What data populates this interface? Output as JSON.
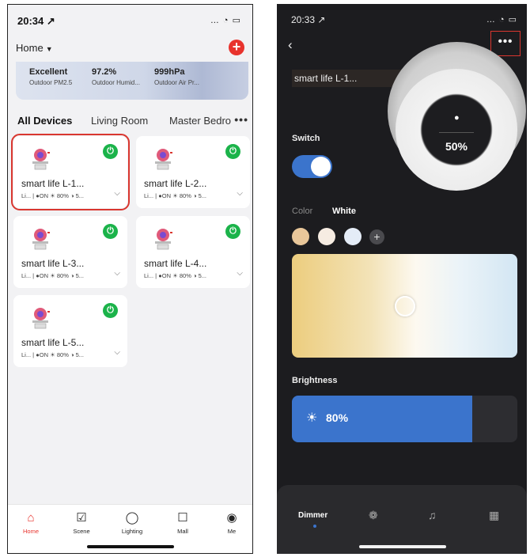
{
  "left": {
    "status": {
      "time": "20:34 ↗",
      "system": "… ◔ ▭"
    },
    "home_label": "Home",
    "caret": "▼",
    "add": "+",
    "weather": [
      {
        "value": "Excellent",
        "label": "Outdoor PM2.5"
      },
      {
        "value": "97.2%",
        "label": "Outdoor Humid..."
      },
      {
        "value": "999hPa",
        "label": "Outdoor Air Pr..."
      }
    ],
    "tabs": [
      "All Devices",
      "Living Room",
      "Master Bedro"
    ],
    "tabs_more": "•••",
    "devices": [
      {
        "name": "smart life L-1...",
        "status": "Li...  |  ●ON  ☀ 80%  ◑ 5...",
        "power": "⏻",
        "selected": true
      },
      {
        "name": "smart life L-2...",
        "status": "Li...  |  ●ON  ☀ 80%  ◑ 5...",
        "power": "⏻",
        "selected": false
      },
      {
        "name": "smart life L-3...",
        "status": "Li...  |  ●ON  ☀ 80%  ◑ 5...",
        "power": "⏻",
        "selected": false
      },
      {
        "name": "smart life L-4...",
        "status": "Li...  |  ●ON  ☀ 80%  ◑ 5...",
        "power": "⏻",
        "selected": false
      },
      {
        "name": "smart life L-5...",
        "status": "Li...  |  ●ON  ☀ 80%  ◑ 5...",
        "power": "⏻",
        "selected": false
      }
    ],
    "chevron": "⌵",
    "nav": [
      {
        "label": "Home",
        "icon": "home-icon",
        "glyph": "⌂",
        "active": true
      },
      {
        "label": "Scene",
        "icon": "scene-icon",
        "glyph": "☑",
        "active": false
      },
      {
        "label": "Lighting",
        "icon": "bulb-icon",
        "glyph": "◯",
        "active": false
      },
      {
        "label": "Mall",
        "icon": "bag-icon",
        "glyph": "☐",
        "active": false
      },
      {
        "label": "Me",
        "icon": "profile-icon",
        "glyph": "◉",
        "active": false
      }
    ],
    "colors": {
      "accent": "#e8332d",
      "power": "#1bb34a"
    }
  },
  "right": {
    "status": {
      "time": "20:33 ↗",
      "system": "… ◔ ▭"
    },
    "back": "‹",
    "more": "•••",
    "device_title": "smart life L-1...",
    "ring_percent": "50%",
    "bulb_glyph": "●",
    "switch_label": "Switch",
    "switch_on": true,
    "color_tab": "Color",
    "white_tab": "White",
    "swatches": [
      "#e9c79a",
      "#f6ece2",
      "#e4ecf7"
    ],
    "swatch_plus": "+",
    "brightness_label": "Brightness",
    "brightness": 0.8,
    "brightness_text": "80%",
    "sun_glyph": "☀",
    "nav": [
      {
        "label": "Dimmer",
        "icon": "dimmer-icon"
      },
      {
        "label": "",
        "icon": "palette-icon",
        "glyph": "❁"
      },
      {
        "label": "",
        "icon": "music-icon",
        "glyph": "♫"
      },
      {
        "label": "",
        "icon": "grid-icon",
        "glyph": "▦"
      }
    ],
    "colors": {
      "accent": "#3b74cc",
      "background": "#1c1c1f"
    }
  }
}
